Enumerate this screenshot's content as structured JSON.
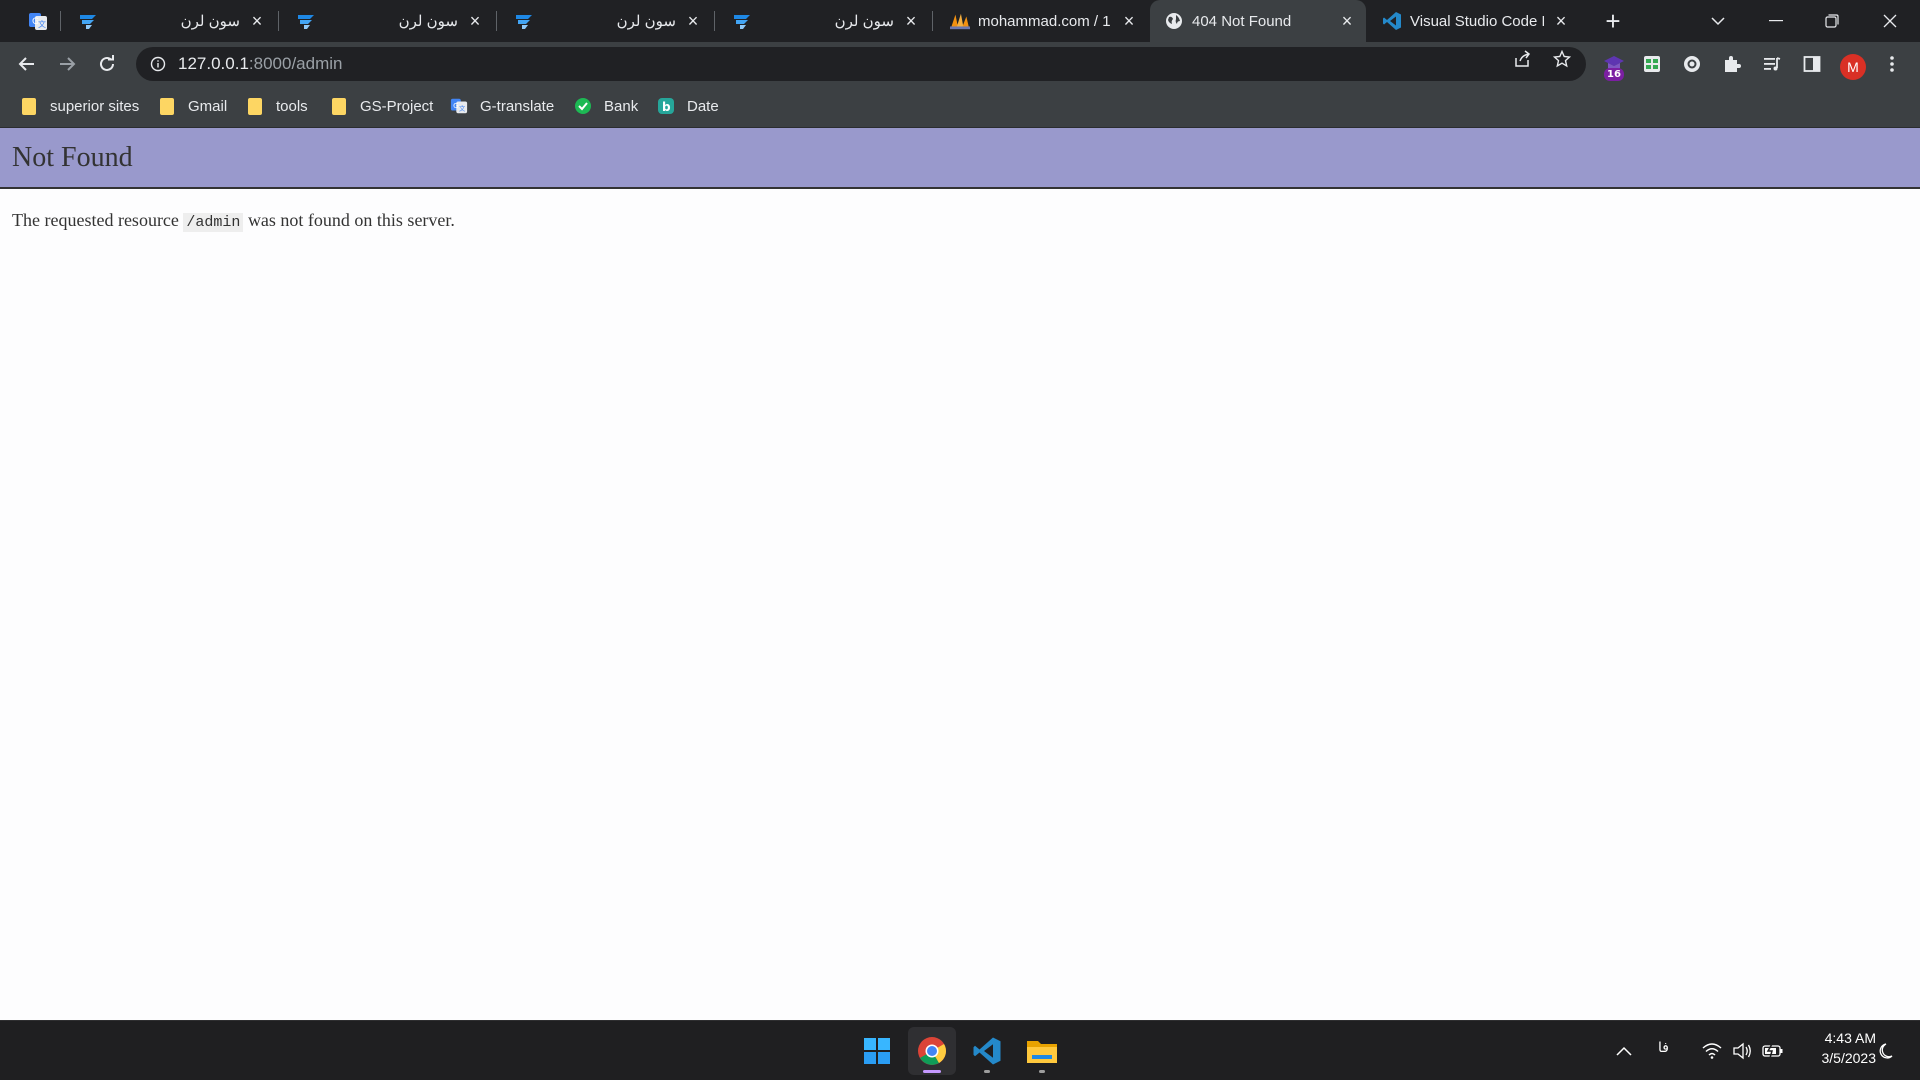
{
  "browser": {
    "tabs": [
      {
        "title": "",
        "icon": "google-translate-icon"
      },
      {
        "title": "سون لرن",
        "icon": "sevenlearn-icon"
      },
      {
        "title": "سون لرن",
        "icon": "sevenlearn-icon"
      },
      {
        "title": "سون لرن",
        "icon": "sevenlearn-icon"
      },
      {
        "title": "سون لرن",
        "icon": "sevenlearn-icon"
      },
      {
        "title": "mohammad.com / 1",
        "icon": "phpmyadmin-icon"
      },
      {
        "title": "404 Not Found",
        "icon": "globe-icon",
        "active": true
      },
      {
        "title": "Visual Studio Code K",
        "icon": "vscode-icon"
      }
    ],
    "url": {
      "host": "127.0.0.1",
      "path": ":8000/admin"
    },
    "extension_badge": "16",
    "profile_initial": "M",
    "bookmarks": [
      {
        "label": "superior sites",
        "icon": "folder-icon"
      },
      {
        "label": "Gmail",
        "icon": "folder-icon"
      },
      {
        "label": "tools",
        "icon": "folder-icon"
      },
      {
        "label": "GS-Project",
        "icon": "folder-icon"
      },
      {
        "label": "G-translate",
        "icon": "google-translate-icon"
      },
      {
        "label": "Bank",
        "icon": "bank-icon"
      },
      {
        "label": "Date",
        "icon": "date-icon"
      }
    ]
  },
  "page": {
    "heading": "Not Found",
    "message_before": "The requested resource",
    "resource": "/admin",
    "message_after": "was not found on this server.",
    "header_color": "#9999cc"
  },
  "taskbar": {
    "apps": [
      "windows-start-icon",
      "chrome-icon",
      "vscode-icon",
      "file-explorer-icon"
    ],
    "language": "فا",
    "time": "4:43 AM",
    "date": "3/5/2023"
  }
}
